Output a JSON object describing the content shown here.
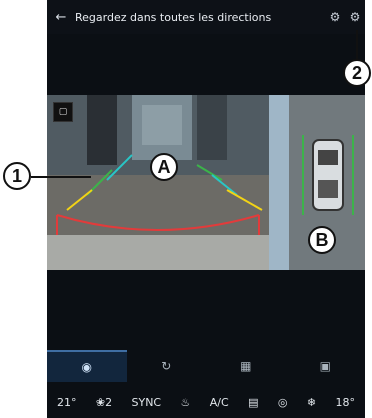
{
  "header": {
    "back_icon": "back-arrow-icon",
    "title": "Regardez dans toutes les directions",
    "icons": [
      "camera-settings-icon",
      "gear-icon"
    ]
  },
  "camera_view": {
    "mode_icon": "view-mode-icon"
  },
  "callouts": [
    "1",
    "2",
    "A",
    "B"
  ],
  "tabs": [
    {
      "icon": "rear-camera-icon",
      "active": true
    },
    {
      "icon": "front-camera-icon",
      "active": false
    },
    {
      "icon": "side-camera-icon",
      "active": false
    },
    {
      "icon": "mirror-camera-icon",
      "active": false
    }
  ],
  "climate": {
    "left_temp": "21°",
    "fan_level": "2",
    "sync": "SYNC",
    "ac": "A/C",
    "right_temp": "18°"
  }
}
